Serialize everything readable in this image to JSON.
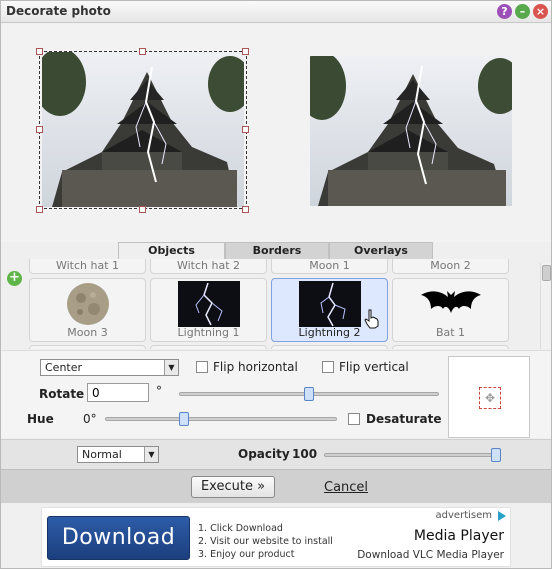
{
  "window": {
    "title": "Decorate photo",
    "help_symbol": "?",
    "minimize_symbol": "–",
    "close_symbol": "×"
  },
  "tabs": [
    {
      "label": "Objects",
      "active": true
    },
    {
      "label": "Borders",
      "active": false
    },
    {
      "label": "Overlays",
      "active": false
    }
  ],
  "gallery": {
    "add_symbol": "+",
    "top_row": [
      "Witch hat 1",
      "Witch hat 2",
      "Moon 1",
      "Moon 2"
    ],
    "items": [
      {
        "label": "Moon 3",
        "icon": "moon-icon",
        "selected": false
      },
      {
        "label": "Lightning 1",
        "icon": "lightning-icon",
        "selected": false
      },
      {
        "label": "Lightning 2",
        "icon": "lightning-icon",
        "selected": true
      },
      {
        "label": "Bat 1",
        "icon": "bat-icon",
        "selected": false
      }
    ]
  },
  "controls": {
    "position_select": "Center",
    "flip_horizontal_label": "Flip horizontal",
    "flip_vertical_label": "Flip vertical",
    "rotate_label": "Rotate",
    "rotate_value": "0",
    "degree_symbol": "°",
    "hue_label": "Hue",
    "hue_value": "0°",
    "desaturate_label": "Desaturate",
    "rotate_slider_fraction": 0.5,
    "hue_slider_fraction": 0.34,
    "anchor_symbol": "✥"
  },
  "blend": {
    "mode_select": "Normal",
    "opacity_label": "Opacity",
    "opacity_value": "100",
    "opacity_slider_fraction": 1.0
  },
  "actions": {
    "execute_label": "Execute »",
    "cancel_label": "Cancel"
  },
  "ad": {
    "tag": "advertisem",
    "download_label": "Download",
    "steps": [
      "1. Click Download",
      "2. Visit our website to install",
      "3. Enjoy our product"
    ],
    "title": "Media Player",
    "subtitle": "Download VLC Media Player"
  },
  "colors": {
    "selection_highlight": "#dde8ff",
    "ad_button": "#2d5ca8",
    "help_button": "#9c4fb6",
    "minimize_button": "#58a94c",
    "close_button": "#d9534f"
  }
}
